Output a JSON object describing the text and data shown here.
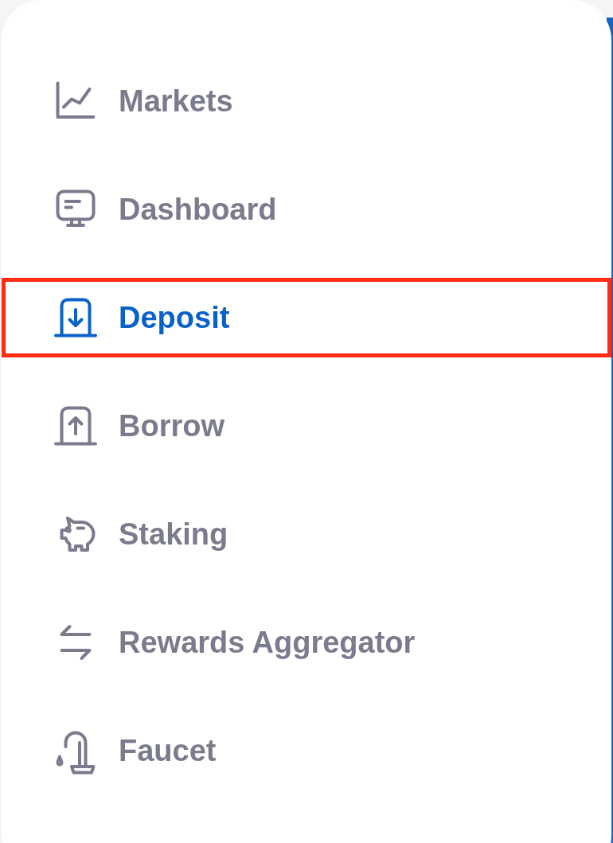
{
  "menu": {
    "items": [
      {
        "kind": "chart",
        "label": "Markets",
        "selected": false
      },
      {
        "kind": "monitor",
        "label": "Dashboard",
        "selected": false
      },
      {
        "kind": "deposit",
        "label": "Deposit",
        "selected": true
      },
      {
        "kind": "borrow",
        "label": "Borrow",
        "selected": false
      },
      {
        "kind": "piggy",
        "label": "Staking",
        "selected": false
      },
      {
        "kind": "swap",
        "label": "Rewards Aggregator",
        "selected": false
      },
      {
        "kind": "faucet",
        "label": "Faucet",
        "selected": false
      }
    ]
  }
}
